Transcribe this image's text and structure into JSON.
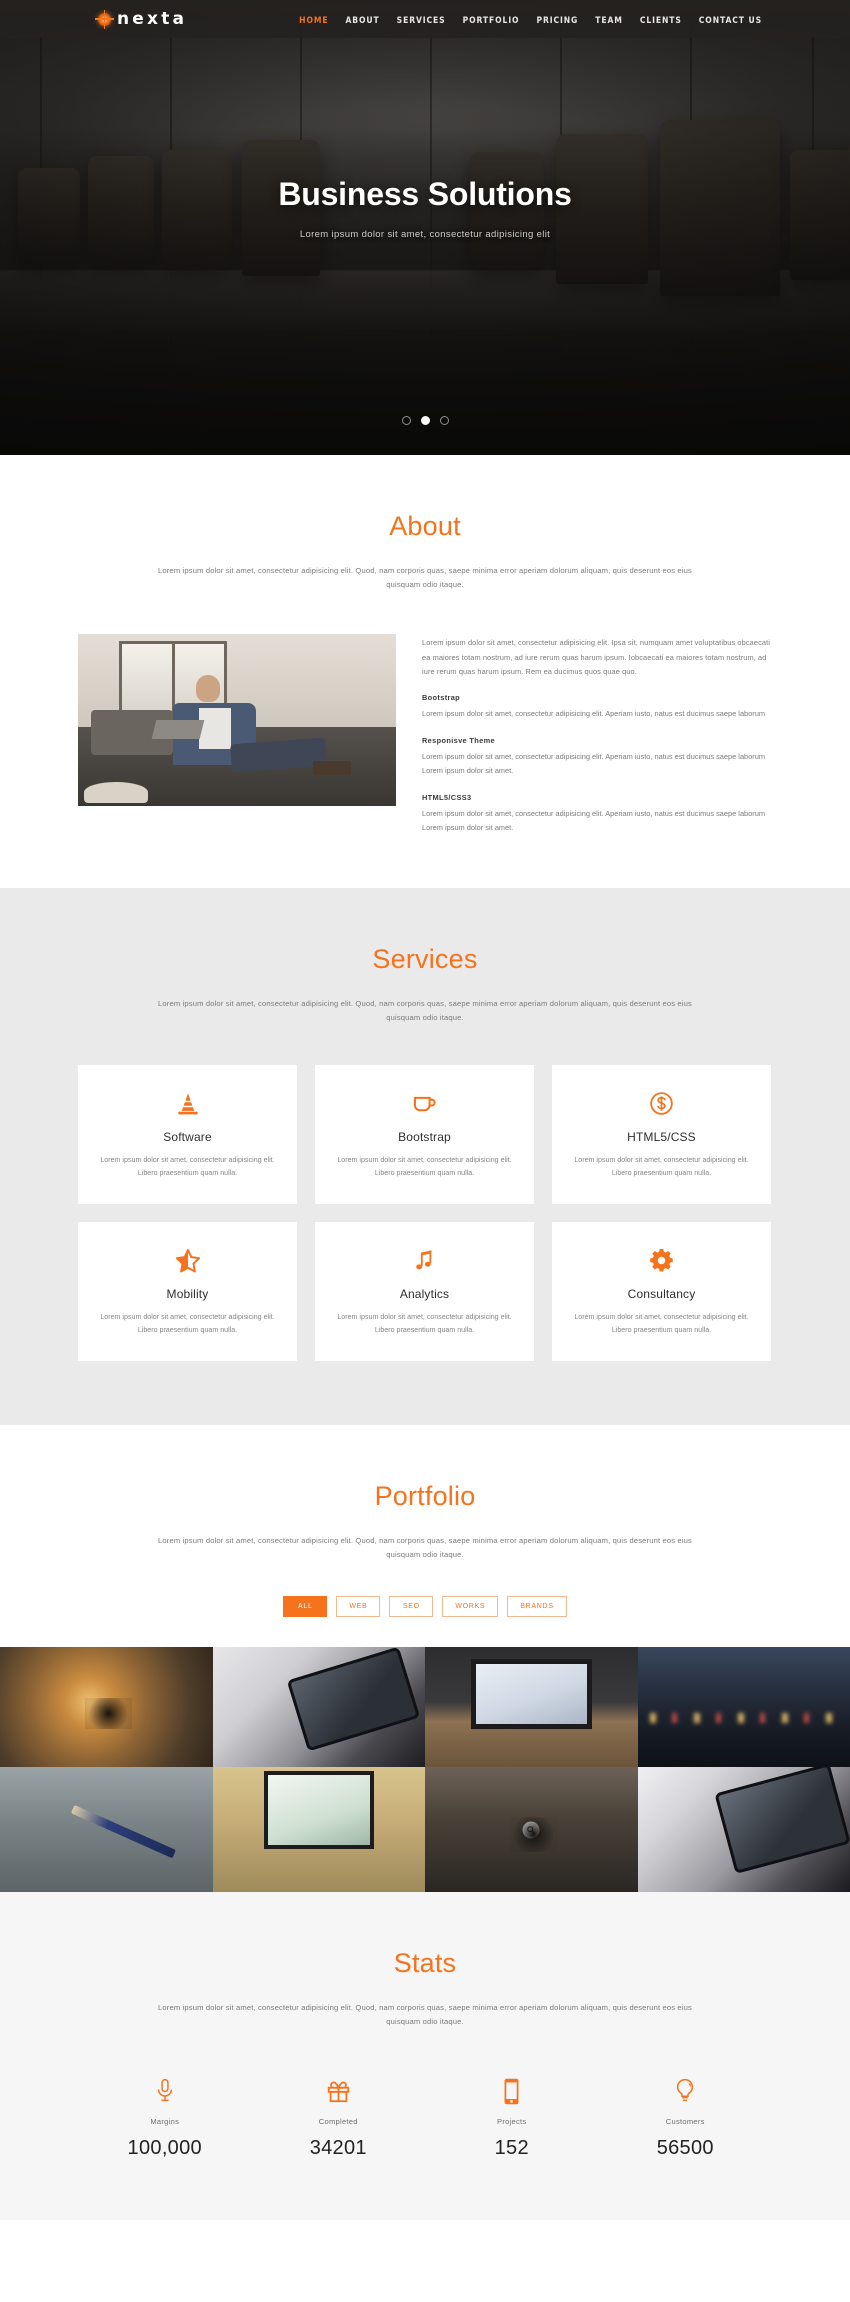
{
  "header": {
    "logo_text": "nexta",
    "logo_icon": "sun-burst-icon",
    "nav": [
      {
        "label": "HOME",
        "active": true
      },
      {
        "label": "ABOUT",
        "active": false
      },
      {
        "label": "SERVICES",
        "active": false
      },
      {
        "label": "PORTFOLIO",
        "active": false
      },
      {
        "label": "PRICING",
        "active": false
      },
      {
        "label": "TEAM",
        "active": false
      },
      {
        "label": "CLIENTS",
        "active": false
      },
      {
        "label": "CONTACT US",
        "active": false
      }
    ]
  },
  "hero": {
    "title": "Business Solutions",
    "subtitle": "Lorem ipsum dolor sit amet, consectetur adipisicing elit",
    "slides": 3,
    "active_slide": 2
  },
  "about": {
    "title": "About",
    "description": "Lorem ipsum dolor sit amet, consectetur adipisicing elit. Quod, nam corporis quas, saepe minima error aperiam dolorum aliquam, quis deserunt eos eius quisquam odio itaque.",
    "lead": "Lorem ipsum dolor sit amet, consectetur adipisicing elit. Ipsa sit, numquam amet voluptatibus obcaecati ea maiores totam nostrum, ad iure rerum quas harum ipsum. Iobcaecati ea maiores totam nostrum, ad iure rerum quas harum ipsum. Rem ea ducimus quos quae quo.",
    "blocks": [
      {
        "heading": "Bootstrap",
        "body": "Lorem ipsum dolor sit amet, consectetur adipisicing elit. Aperiam iusto, natus est ducimus saepe laborum"
      },
      {
        "heading": "Responisve Theme",
        "body": "Lorem ipsum dolor sit amet, consectetur adipisicing elit. Aperiam iusto, natus est ducimus saepe laborum Lorem ipsum dolor sit amet."
      },
      {
        "heading": "HTML5/CSS3",
        "body": "Lorem ipsum dolor sit amet, consectetur adipisicing elit. Aperiam iusto, natus est ducimus saepe laborum Lorem ipsum dolor sit amet."
      }
    ]
  },
  "services": {
    "title": "Services",
    "description": "Lorem ipsum dolor sit amet, consectetur adipisicing elit. Quod, nam corporis quas, saepe minima error aperiam dolorum aliquam, quis deserunt eos eius quisquam odio itaque.",
    "items": [
      {
        "icon": "traffic-cone-icon",
        "name": "Software",
        "desc": "Lorem ipsum dolor sit amet, consectetur adipisicing elit. Libero praesentium quam nulla."
      },
      {
        "icon": "coffee-cup-icon",
        "name": "Bootstrap",
        "desc": "Lorem ipsum dolor sit amet, consectetur adipisicing elit. Libero praesentium quam nulla."
      },
      {
        "icon": "dollar-circle-icon",
        "name": "HTML5/CSS",
        "desc": "Lorem ipsum dolor sit amet, consectetur adipisicing elit. Libero praesentium quam nulla."
      },
      {
        "icon": "half-star-icon",
        "name": "Mobility",
        "desc": "Lorem ipsum dolor sit amet, consectetur adipisicing elit. Libero praesentium quam nulla."
      },
      {
        "icon": "music-note-icon",
        "name": "Analytics",
        "desc": "Lorem ipsum dolor sit amet, consectetur adipisicing elit. Libero praesentium quam nulla."
      },
      {
        "icon": "gear-icon",
        "name": "Consultancy",
        "desc": "Lorem ipsum dolor sit amet, consectetur adipisicing elit. Libero praesentium quam nulla."
      }
    ]
  },
  "portfolio": {
    "title": "Portfolio",
    "description": "Lorem ipsum dolor sit amet, consectetur adipisicing elit. Quod, nam corporis quas, saepe minima error aperiam dolorum aliquam, quis deserunt eos eius quisquam odio itaque.",
    "filters": [
      {
        "label": "ALL",
        "active": true
      },
      {
        "label": "WEB",
        "active": false
      },
      {
        "label": "SEO",
        "active": false
      },
      {
        "label": "WORKS",
        "active": false
      },
      {
        "label": "BRANDS",
        "active": false
      }
    ],
    "items": [
      {
        "photo": "ph-sunset",
        "alt": "drone silhouette at sunset on wet sand"
      },
      {
        "photo": "ph-ipad",
        "alt": "tablet leaning on laptop keyboard"
      },
      {
        "photo": "ph-imac",
        "alt": "imac desktop computer on wooden desk"
      },
      {
        "photo": "ph-street",
        "alt": "blurred city street at dusk with bokeh lights"
      },
      {
        "photo": "ph-pencil",
        "alt": "pencil on concrete blocks miniature"
      },
      {
        "photo": "ph-desk",
        "alt": "imac workstation with keyboard and headphones"
      },
      {
        "photo": "ph-drone",
        "alt": "drone on sand",
        "hover_zoom": true
      },
      {
        "photo": "ph-ipad2",
        "alt": "tablet leaning on laptop keyboard"
      }
    ],
    "zoom_icon": "magnifier-icon"
  },
  "stats": {
    "title": "Stats",
    "description": "Lorem ipsum dolor sit amet, consectetur adipisicing elit. Quod, nam corporis quas, saepe minima error aperiam dolorum aliquam, quis deserunt eos eius quisquam odio itaque.",
    "items": [
      {
        "icon": "microphone-icon",
        "label": "Margins",
        "value": "100,000"
      },
      {
        "icon": "gift-icon",
        "label": "Completed",
        "value": "34201"
      },
      {
        "icon": "mobile-phone-icon",
        "label": "Projects",
        "value": "152"
      },
      {
        "icon": "lightbulb-icon",
        "label": "Customers",
        "value": "56500"
      }
    ]
  },
  "colors": {
    "accent": "#f4731c",
    "dark": "#262422",
    "services_bg": "#eaeaea",
    "stats_bg": "#f6f6f6",
    "body_text": "#7b7b7b"
  }
}
